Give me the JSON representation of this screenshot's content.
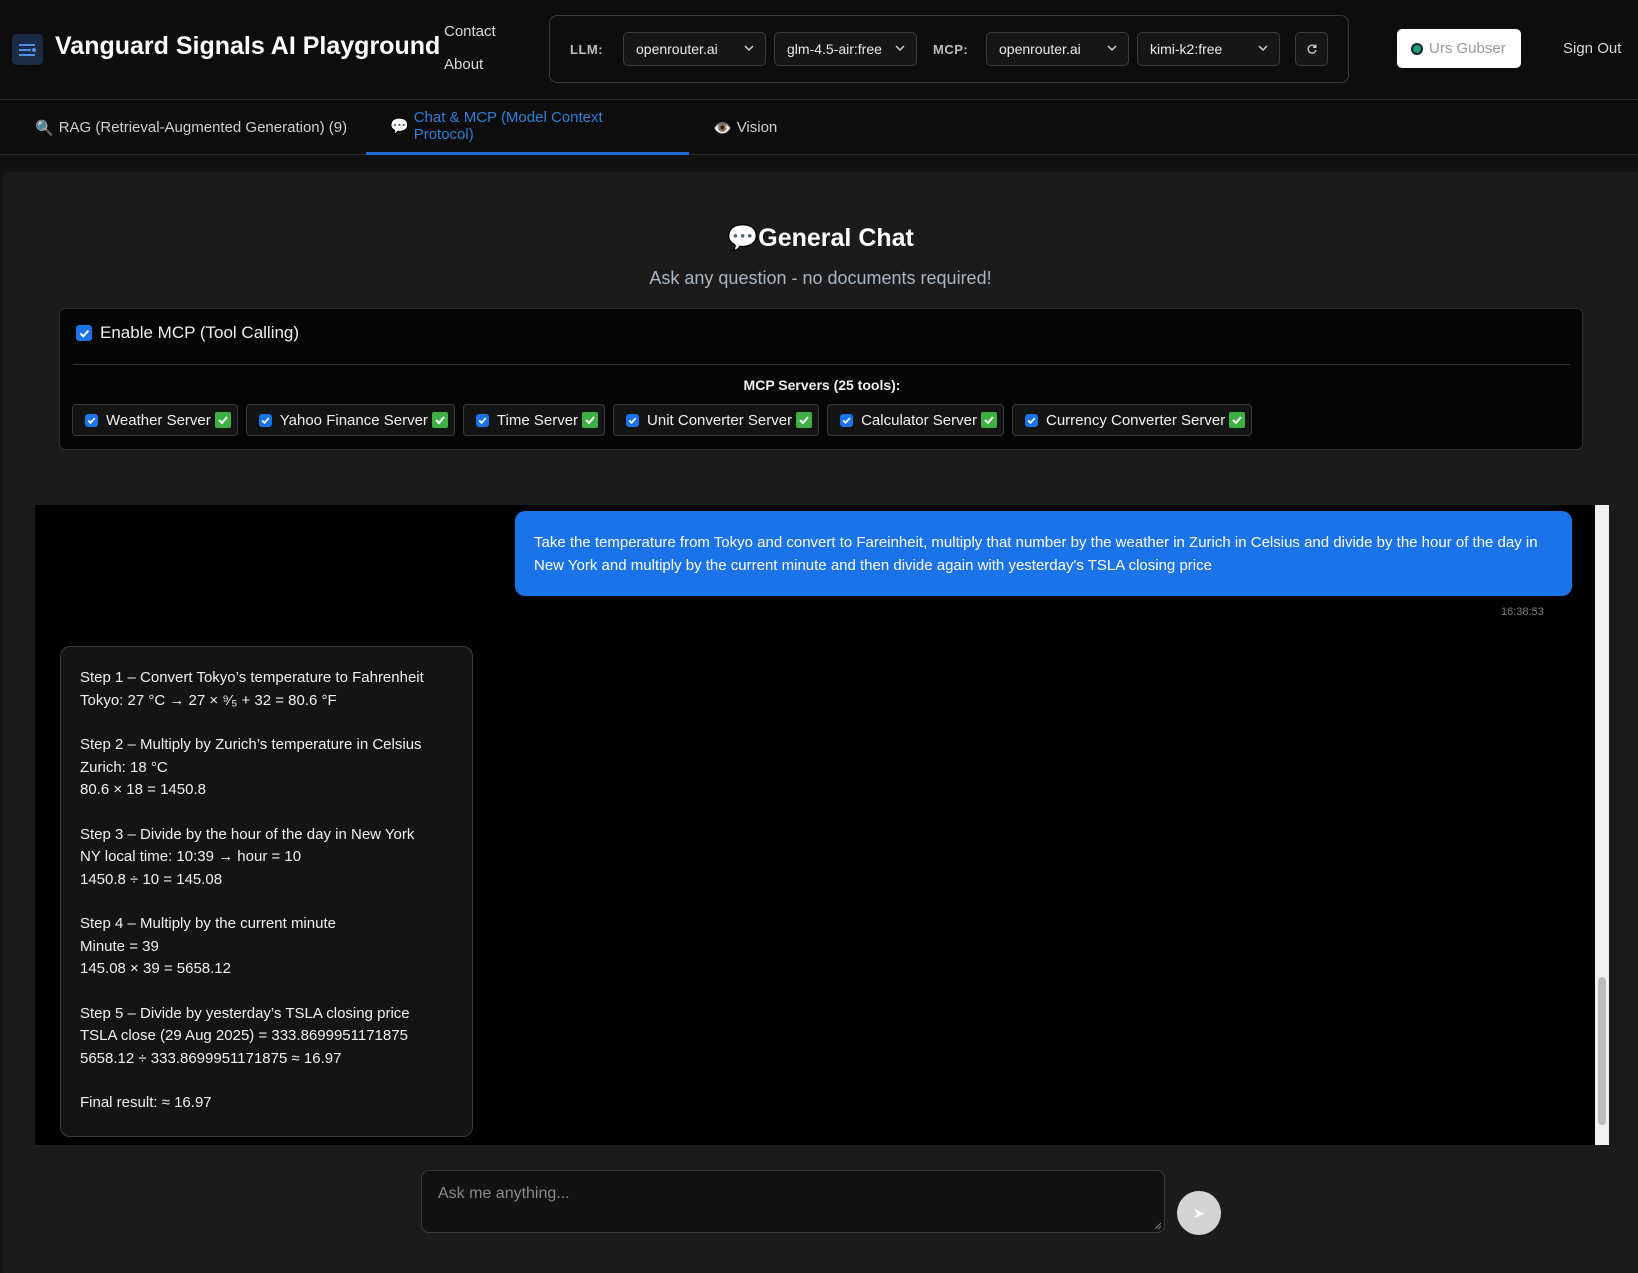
{
  "header": {
    "title": "Vanguard Signals AI Playground",
    "logo_icon": "menu-lines-icon",
    "nav": {
      "contact": "Contact",
      "about": "About"
    },
    "models": {
      "llm_label": "LLM:",
      "llm_provider": "openrouter.ai",
      "llm_model": "glm-4.5-air:free",
      "mcp_label": "MCP:",
      "mcp_provider": "openrouter.ai",
      "mcp_model": "kimi-k2:free",
      "refresh_icon": "refresh-icon"
    },
    "user_name": "Urs Gubser",
    "sign_out": "Sign Out"
  },
  "tabs": [
    {
      "icon": "🔍",
      "label": "RAG (Retrieval-Augmented Generation) (9)",
      "active": false
    },
    {
      "icon": "💬",
      "label": "Chat & MCP (Model Context Protocol)",
      "active": true
    },
    {
      "icon": "👁️",
      "label": "Vision",
      "active": false
    }
  ],
  "chat": {
    "title_icon": "💬",
    "title": "General Chat",
    "subtitle": "Ask any question - no documents required!",
    "mcp_enable_label": "Enable MCP (Tool Calling)",
    "mcp_enabled": true,
    "servers_title": "MCP Servers (25 tools):",
    "servers": [
      {
        "name": "Weather Server",
        "checked": true
      },
      {
        "name": "Yahoo Finance Server",
        "checked": true
      },
      {
        "name": "Time Server",
        "checked": true
      },
      {
        "name": "Unit Converter Server",
        "checked": true
      },
      {
        "name": "Calculator Server",
        "checked": true
      },
      {
        "name": "Currency Converter Server",
        "checked": true
      }
    ]
  },
  "messages": {
    "user_text": "Take the temperature from Tokyo and convert to Fareinheit, multiply that number by the weather in Zurich in Celsius and divide by the hour of the day in New York and multiply by the current minute and then divide again with yesterday's TSLA closing price",
    "user_time": "16:38:53",
    "bot_steps": [
      [
        "Step 1 – Convert Tokyo’s temperature to Fahrenheit",
        "Tokyo: 27 °C → 27 × ⁹⁄₅ + 32 = 80.6 °F"
      ],
      [
        "Step 2 – Multiply by Zurich’s temperature in Celsius",
        "Zurich: 18 °C",
        "80.6 × 18 = 1450.8"
      ],
      [
        "Step 3 – Divide by the hour of the day in New York",
        "NY local time: 10:39 → hour = 10",
        "1450.8 ÷ 10 = 145.08"
      ],
      [
        "Step 4 – Multiply by the current minute",
        "Minute = 39",
        "145.08 × 39 = 5658.12"
      ],
      [
        "Step 5 – Divide by yesterday’s TSLA closing price",
        "TSLA close (29 Aug 2025) = 333.8699951171875",
        "5658.12 ÷ 333.8699951171875 ≈ 16.97"
      ],
      [
        "Final result: ≈ 16.97"
      ]
    ]
  },
  "input": {
    "placeholder": "Ask me anything...",
    "send_icon": "send-icon"
  },
  "colors": {
    "accent": "#1a73e8",
    "tab_active": "#2e7fd9",
    "check_green": "#3cb043",
    "status_dot": "#1f9d77"
  }
}
